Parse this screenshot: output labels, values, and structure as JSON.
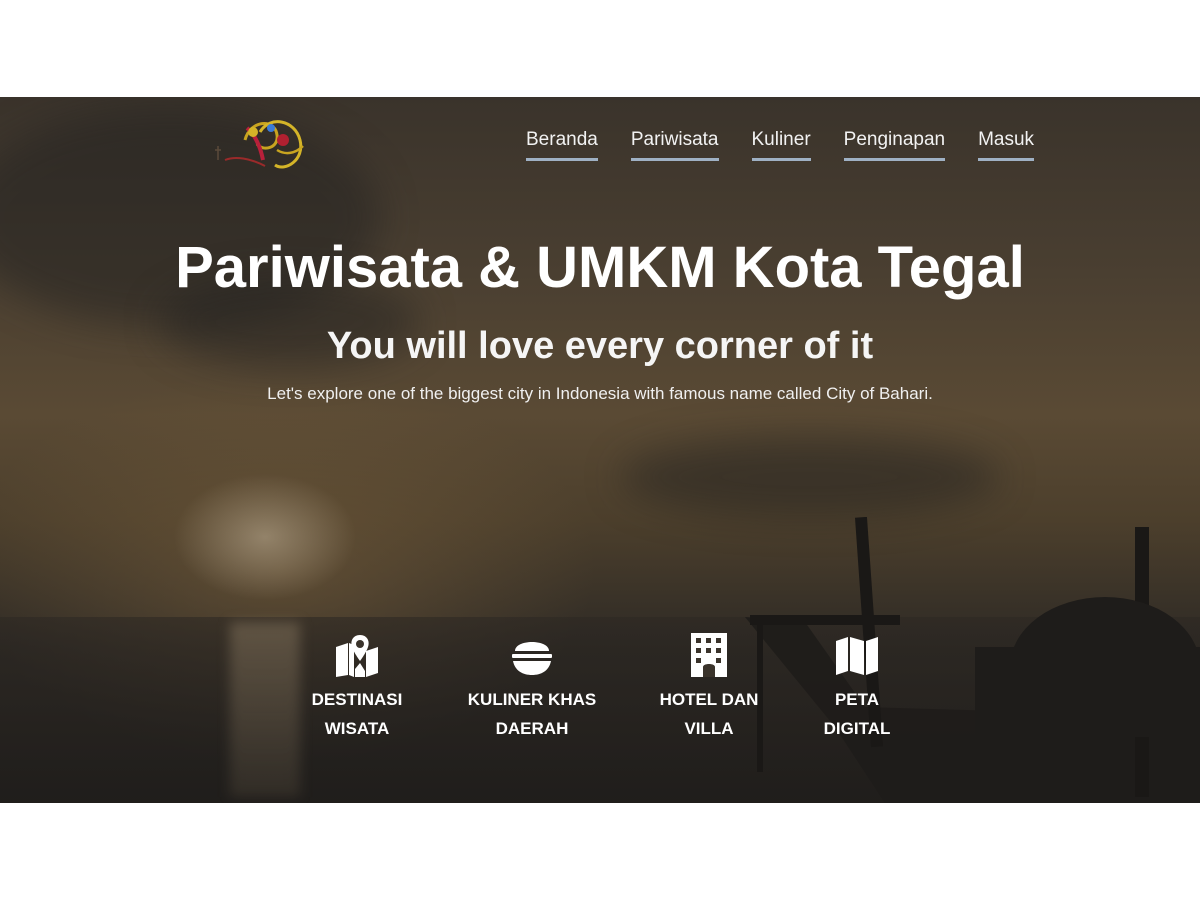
{
  "nav": {
    "items": [
      {
        "label": "Beranda"
      },
      {
        "label": "Pariwisata"
      },
      {
        "label": "Kuliner"
      },
      {
        "label": "Penginapan"
      },
      {
        "label": "Masuk"
      }
    ]
  },
  "hero": {
    "title": "Pariwisata & UMKM Kota Tegal",
    "subtitle": "You will love every corner of it",
    "tagline": "Let's explore one of the biggest city in Indonesia with famous name called City of Bahari."
  },
  "features": [
    {
      "label": "DESTINASI\nWISATA",
      "icon": "map-pin-icon"
    },
    {
      "label": "KULINER KHAS\nDAERAH",
      "icon": "food-bowl-icon"
    },
    {
      "label": "HOTEL DAN\nVILLA",
      "icon": "hotel-icon"
    },
    {
      "label": "PETA\nDIGITAL",
      "icon": "folded-map-icon"
    }
  ],
  "colors": {
    "nav_underline": "#9fb1c4",
    "text": "#ffffff"
  }
}
